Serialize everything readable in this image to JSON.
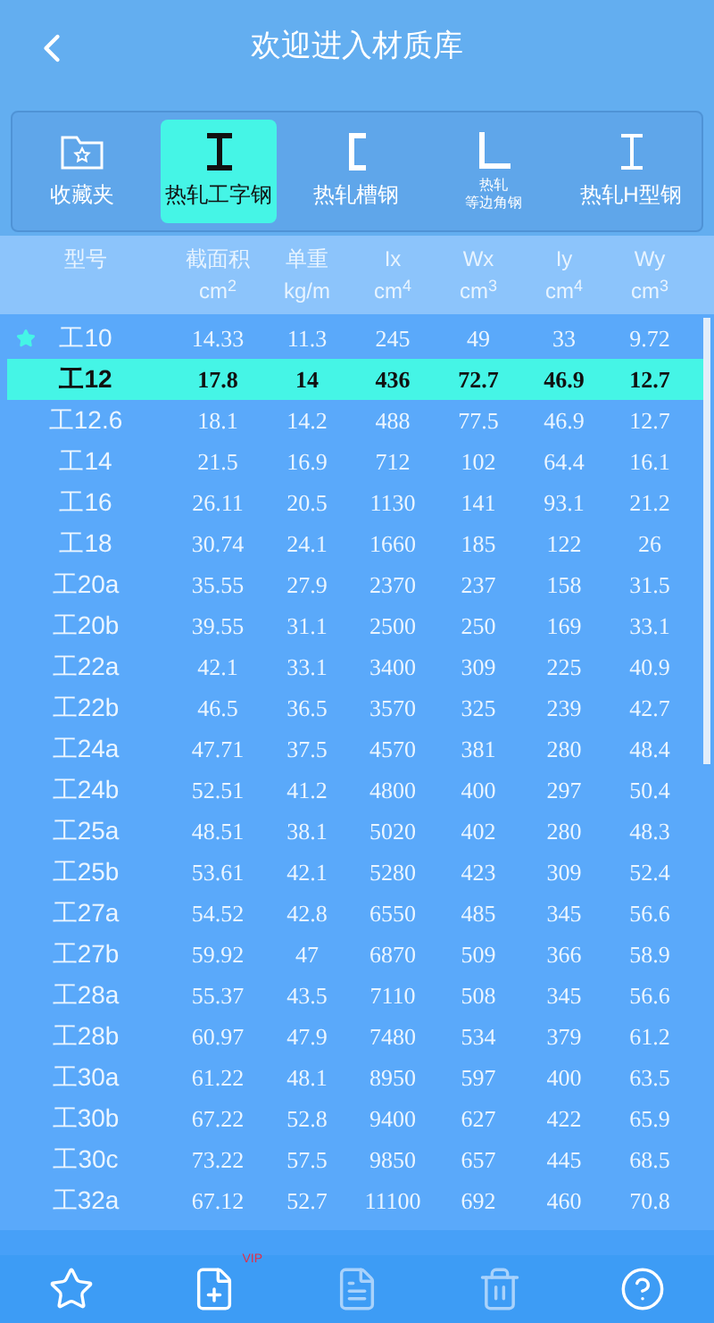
{
  "header": {
    "title": "欢迎进入材质库"
  },
  "categories": [
    {
      "label": "收藏夹",
      "selected": false
    },
    {
      "label": "热轧工字钢",
      "selected": true
    },
    {
      "label": "热轧槽钢",
      "selected": false
    },
    {
      "label": "热轧",
      "label_2": "等边角钢",
      "selected": false
    },
    {
      "label": "热轧H型钢",
      "selected": false
    }
  ],
  "table": {
    "columns": [
      {
        "name": "型号"
      },
      {
        "name": "截面积",
        "unit": "cm$^{2}$"
      },
      {
        "name": "单重",
        "unit": "kg/m"
      },
      {
        "name": "Ix",
        "unit": "cm$^{4}$"
      },
      {
        "name": "Wx",
        "unit": "cm$^{3}$"
      },
      {
        "name": "Iy",
        "unit": "cm$^{4}$"
      },
      {
        "name": "Wy",
        "unit": "cm$^{3}$"
      }
    ],
    "rows": [
      {
        "favorite": true,
        "selected": false,
        "cells": [
          "工10",
          "14.33",
          "11.3",
          "245",
          "49",
          "33",
          "9.72"
        ]
      },
      {
        "favorite": false,
        "selected": true,
        "cells": [
          "工12",
          "17.8",
          "14",
          "436",
          "72.7",
          "46.9",
          "12.7"
        ]
      },
      {
        "favorite": false,
        "selected": false,
        "cells": [
          "工12.6",
          "18.1",
          "14.2",
          "488",
          "77.5",
          "46.9",
          "12.7"
        ]
      },
      {
        "favorite": false,
        "selected": false,
        "cells": [
          "工14",
          "21.5",
          "16.9",
          "712",
          "102",
          "64.4",
          "16.1"
        ]
      },
      {
        "favorite": false,
        "selected": false,
        "cells": [
          "工16",
          "26.11",
          "20.5",
          "1130",
          "141",
          "93.1",
          "21.2"
        ]
      },
      {
        "favorite": false,
        "selected": false,
        "cells": [
          "工18",
          "30.74",
          "24.1",
          "1660",
          "185",
          "122",
          "26"
        ]
      },
      {
        "favorite": false,
        "selected": false,
        "cells": [
          "工20a",
          "35.55",
          "27.9",
          "2370",
          "237",
          "158",
          "31.5"
        ]
      },
      {
        "favorite": false,
        "selected": false,
        "cells": [
          "工20b",
          "39.55",
          "31.1",
          "2500",
          "250",
          "169",
          "33.1"
        ]
      },
      {
        "favorite": false,
        "selected": false,
        "cells": [
          "工22a",
          "42.1",
          "33.1",
          "3400",
          "309",
          "225",
          "40.9"
        ]
      },
      {
        "favorite": false,
        "selected": false,
        "cells": [
          "工22b",
          "46.5",
          "36.5",
          "3570",
          "325",
          "239",
          "42.7"
        ]
      },
      {
        "favorite": false,
        "selected": false,
        "cells": [
          "工24a",
          "47.71",
          "37.5",
          "4570",
          "381",
          "280",
          "48.4"
        ]
      },
      {
        "favorite": false,
        "selected": false,
        "cells": [
          "工24b",
          "52.51",
          "41.2",
          "4800",
          "400",
          "297",
          "50.4"
        ]
      },
      {
        "favorite": false,
        "selected": false,
        "cells": [
          "工25a",
          "48.51",
          "38.1",
          "5020",
          "402",
          "280",
          "48.3"
        ]
      },
      {
        "favorite": false,
        "selected": false,
        "cells": [
          "工25b",
          "53.61",
          "42.1",
          "5280",
          "423",
          "309",
          "52.4"
        ]
      },
      {
        "favorite": false,
        "selected": false,
        "cells": [
          "工27a",
          "54.52",
          "42.8",
          "6550",
          "485",
          "345",
          "56.6"
        ]
      },
      {
        "favorite": false,
        "selected": false,
        "cells": [
          "工27b",
          "59.92",
          "47",
          "6870",
          "509",
          "366",
          "58.9"
        ]
      },
      {
        "favorite": false,
        "selected": false,
        "cells": [
          "工28a",
          "55.37",
          "43.5",
          "7110",
          "508",
          "345",
          "56.6"
        ]
      },
      {
        "favorite": false,
        "selected": false,
        "cells": [
          "工28b",
          "60.97",
          "47.9",
          "7480",
          "534",
          "379",
          "61.2"
        ]
      },
      {
        "favorite": false,
        "selected": false,
        "cells": [
          "工30a",
          "61.22",
          "48.1",
          "8950",
          "597",
          "400",
          "63.5"
        ]
      },
      {
        "favorite": false,
        "selected": false,
        "cells": [
          "工30b",
          "67.22",
          "52.8",
          "9400",
          "627",
          "422",
          "65.9"
        ]
      },
      {
        "favorite": false,
        "selected": false,
        "cells": [
          "工30c",
          "73.22",
          "57.5",
          "9850",
          "657",
          "445",
          "68.5"
        ]
      },
      {
        "favorite": false,
        "selected": false,
        "cells": [
          "工32a",
          "67.12",
          "52.7",
          "11100",
          "692",
          "460",
          "70.8"
        ]
      }
    ]
  },
  "toolbar": {
    "vip_badge": "VIP"
  }
}
